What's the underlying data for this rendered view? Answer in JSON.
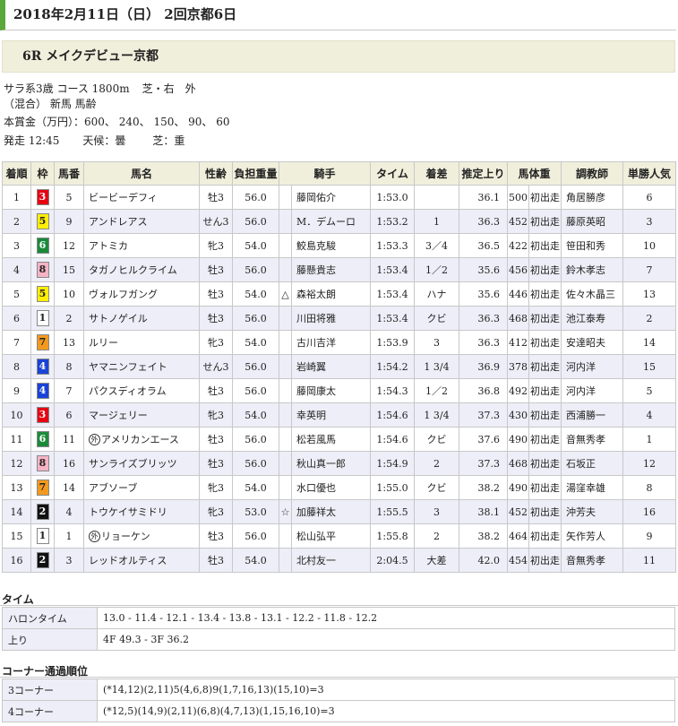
{
  "page": {
    "date_title": "2018年2月11日（日） 2回京都6日",
    "race_title": "6R メイクデビュー京都"
  },
  "info": {
    "line1_a": "サラ系3歳 コース 1800m",
    "line1_b": "芝・右　外",
    "line2": "（混合） 新馬 馬齢",
    "line3": "本賞金（万円）：600、 240、 150、 90、 60",
    "start_time": "発走 12:45",
    "weather": "天候：曇",
    "track": "芝：重"
  },
  "results": {
    "headers": [
      "着順",
      "枠",
      "馬番",
      "馬名",
      "性齢",
      "負担重量",
      "",
      "騎手",
      "タイム",
      "着差",
      "推定上り",
      "馬体重",
      "",
      "調教師",
      "単勝人気"
    ],
    "rows": [
      {
        "pos": "1",
        "waku": "3",
        "num": "5",
        "name": "ビービーデフィ",
        "sex": "牡3",
        "wt": "56.0",
        "mark": "",
        "jockey": "藤岡佑介",
        "time": "1:53.0",
        "margin": "",
        "last": "36.1",
        "bw": "500",
        "bwd": "初出走",
        "trainer": "角居勝彦",
        "pop": "6"
      },
      {
        "pos": "2",
        "waku": "5",
        "num": "9",
        "name": "アンドレアス",
        "sex": "せん3",
        "wt": "56.0",
        "mark": "",
        "jockey": "M．デムーロ",
        "time": "1:53.2",
        "margin": "1",
        "last": "36.3",
        "bw": "452",
        "bwd": "初出走",
        "trainer": "藤原英昭",
        "pop": "3"
      },
      {
        "pos": "3",
        "waku": "6",
        "num": "12",
        "name": "アトミカ",
        "sex": "牝3",
        "wt": "54.0",
        "mark": "",
        "jockey": "鮫島克駿",
        "time": "1:53.3",
        "margin": "3／4",
        "last": "36.5",
        "bw": "422",
        "bwd": "初出走",
        "trainer": "笹田和秀",
        "pop": "10"
      },
      {
        "pos": "4",
        "waku": "8",
        "num": "15",
        "name": "タガノヒルクライム",
        "sex": "牡3",
        "wt": "56.0",
        "mark": "",
        "jockey": "藤懸貴志",
        "time": "1:53.4",
        "margin": "1／2",
        "last": "35.6",
        "bw": "456",
        "bwd": "初出走",
        "trainer": "鈴木孝志",
        "pop": "7"
      },
      {
        "pos": "5",
        "waku": "5",
        "num": "10",
        "name": "ヴォルフガング",
        "sex": "牡3",
        "wt": "54.0",
        "mark": "△",
        "jockey": "森裕太朗",
        "time": "1:53.4",
        "margin": "ハナ",
        "last": "35.6",
        "bw": "446",
        "bwd": "初出走",
        "trainer": "佐々木晶三",
        "pop": "13"
      },
      {
        "pos": "6",
        "waku": "1",
        "num": "2",
        "name": "サトノゲイル",
        "sex": "牡3",
        "wt": "56.0",
        "mark": "",
        "jockey": "川田将雅",
        "time": "1:53.4",
        "margin": "クビ",
        "last": "36.3",
        "bw": "468",
        "bwd": "初出走",
        "trainer": "池江泰寿",
        "pop": "2"
      },
      {
        "pos": "7",
        "waku": "7",
        "num": "13",
        "name": "ルリー",
        "sex": "牝3",
        "wt": "54.0",
        "mark": "",
        "jockey": "古川吉洋",
        "time": "1:53.9",
        "margin": "3",
        "last": "36.3",
        "bw": "412",
        "bwd": "初出走",
        "trainer": "安達昭夫",
        "pop": "14"
      },
      {
        "pos": "8",
        "waku": "4",
        "num": "8",
        "name": "ヤマニンフェイト",
        "sex": "せん3",
        "wt": "56.0",
        "mark": "",
        "jockey": "岩崎翼",
        "time": "1:54.2",
        "margin": "1 3/4",
        "last": "36.9",
        "bw": "378",
        "bwd": "初出走",
        "trainer": "河内洋",
        "pop": "15"
      },
      {
        "pos": "9",
        "waku": "4",
        "num": "7",
        "name": "パクスディオラム",
        "sex": "牡3",
        "wt": "56.0",
        "mark": "",
        "jockey": "藤岡康太",
        "time": "1:54.3",
        "margin": "1／2",
        "last": "36.8",
        "bw": "492",
        "bwd": "初出走",
        "trainer": "河内洋",
        "pop": "5"
      },
      {
        "pos": "10",
        "waku": "3",
        "num": "6",
        "name": "マージェリー",
        "sex": "牝3",
        "wt": "54.0",
        "mark": "",
        "jockey": "幸英明",
        "time": "1:54.6",
        "margin": "1 3/4",
        "last": "37.3",
        "bw": "430",
        "bwd": "初出走",
        "trainer": "西浦勝一",
        "pop": "4"
      },
      {
        "pos": "11",
        "waku": "6",
        "num": "11",
        "name": "アメリカンエース",
        "foreign": "外",
        "sex": "牡3",
        "wt": "56.0",
        "mark": "",
        "jockey": "松若風馬",
        "time": "1:54.6",
        "margin": "クビ",
        "last": "37.6",
        "bw": "490",
        "bwd": "初出走",
        "trainer": "音無秀孝",
        "pop": "1"
      },
      {
        "pos": "12",
        "waku": "8",
        "num": "16",
        "name": "サンライズブリッツ",
        "sex": "牡3",
        "wt": "56.0",
        "mark": "",
        "jockey": "秋山真一郎",
        "time": "1:54.9",
        "margin": "2",
        "last": "37.3",
        "bw": "468",
        "bwd": "初出走",
        "trainer": "石坂正",
        "pop": "12"
      },
      {
        "pos": "13",
        "waku": "7",
        "num": "14",
        "name": "アブソーブ",
        "sex": "牝3",
        "wt": "54.0",
        "mark": "",
        "jockey": "水口優也",
        "time": "1:55.0",
        "margin": "クビ",
        "last": "38.2",
        "bw": "490",
        "bwd": "初出走",
        "trainer": "湯窪幸雄",
        "pop": "8"
      },
      {
        "pos": "14",
        "waku": "2",
        "num": "4",
        "name": "トウケイサミドリ",
        "sex": "牝3",
        "wt": "53.0",
        "mark": "☆",
        "jockey": "加藤祥太",
        "time": "1:55.5",
        "margin": "3",
        "last": "38.1",
        "bw": "452",
        "bwd": "初出走",
        "trainer": "沖芳夫",
        "pop": "16"
      },
      {
        "pos": "15",
        "waku": "1",
        "num": "1",
        "name": "リョーケン",
        "foreign": "外",
        "sex": "牡3",
        "wt": "56.0",
        "mark": "",
        "jockey": "松山弘平",
        "time": "1:55.8",
        "margin": "2",
        "last": "38.2",
        "bw": "464",
        "bwd": "初出走",
        "trainer": "矢作芳人",
        "pop": "9"
      },
      {
        "pos": "16",
        "waku": "2",
        "num": "3",
        "name": "レッドオルティス",
        "sex": "牡3",
        "wt": "54.0",
        "mark": "",
        "jockey": "北村友一",
        "time": "2:04.5",
        "margin": "大差",
        "last": "42.0",
        "bw": "454",
        "bwd": "初出走",
        "trainer": "音無秀孝",
        "pop": "11"
      }
    ]
  },
  "waku_colors": {
    "1": {
      "bg": "#ffffff",
      "fg": "#222222"
    },
    "2": {
      "bg": "#111111",
      "fg": "#ffffff"
    },
    "3": {
      "bg": "#e60012",
      "fg": "#ffffff"
    },
    "4": {
      "bg": "#1a43d6",
      "fg": "#ffffff"
    },
    "5": {
      "bg": "#ffee00",
      "fg": "#222222"
    },
    "6": {
      "bg": "#1a8a3a",
      "fg": "#ffffff"
    },
    "7": {
      "bg": "#f39a1e",
      "fg": "#222222"
    },
    "8": {
      "bg": "#f5b3c5",
      "fg": "#222222"
    }
  },
  "time_section": {
    "title": "タイム",
    "furlong_label": "ハロンタイム",
    "furlong_value": "13.0 - 11.4 - 12.1 - 13.4 - 13.8 - 13.1 - 12.2 - 11.8 - 12.2",
    "last_label": "上り",
    "last_value": "4F 49.3 - 3F 36.2"
  },
  "corner_section": {
    "title": "コーナー通過順位",
    "c3_label": "3コーナー",
    "c3_value": "(*14,12)(2,11)5(4,6,8)9(1,7,16,13)(15,10)=3",
    "c4_label": "4コーナー",
    "c4_value": "(*12,5)(14,9)(2,11)(6,8)(4,7,13)(1,15,16,10)=3"
  }
}
